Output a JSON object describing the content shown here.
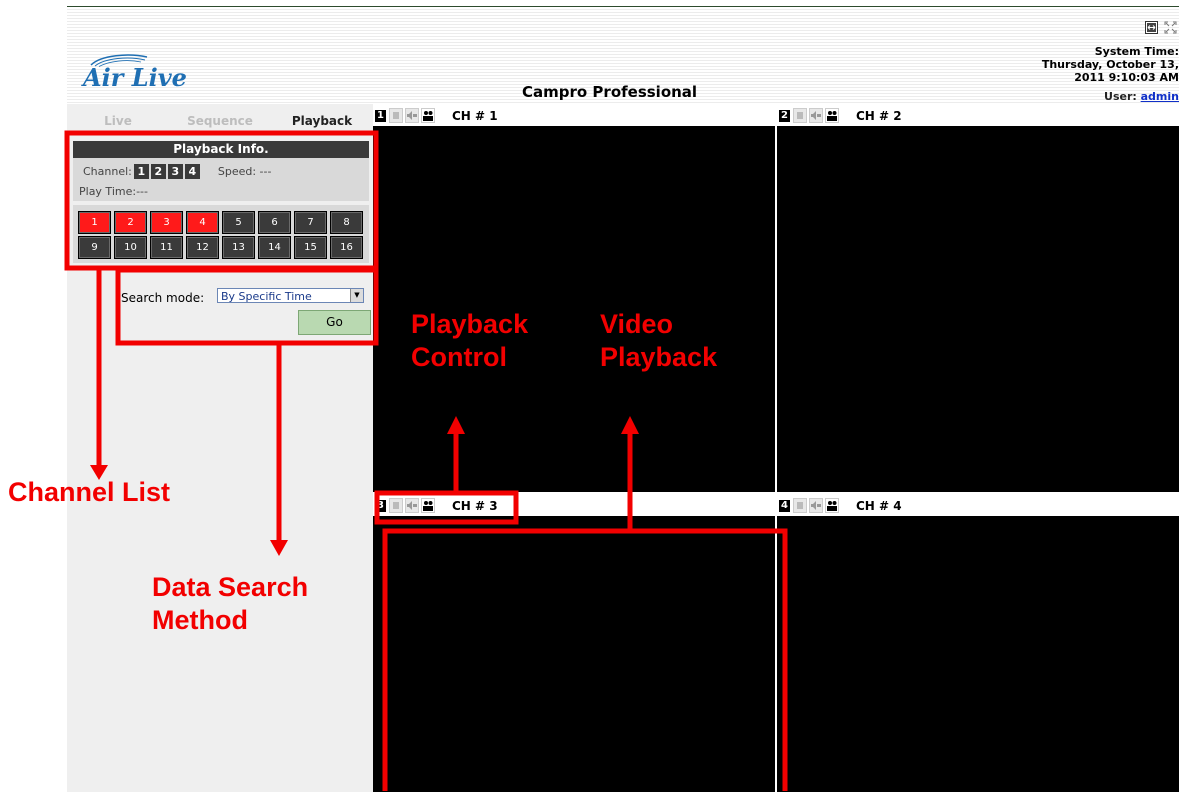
{
  "header": {
    "logo_text": "Air Live",
    "app_title": "Campro Professional",
    "system_time_label": "System Time:",
    "date_line1": "Thursday, October 13,",
    "date_line2": "2011 9:10:03 AM",
    "user_label": "User:",
    "user_name": "admin",
    "icons": [
      "fit-window-icon",
      "fullscreen-icon"
    ]
  },
  "tabs": [
    {
      "label": "Live",
      "active": false
    },
    {
      "label": "Sequence",
      "active": false
    },
    {
      "label": "Playback",
      "active": true
    }
  ],
  "playback_info": {
    "title": "Playback Info.",
    "channel_label": "Channel:",
    "channel_numbers": [
      "1",
      "2",
      "3",
      "4"
    ],
    "speed_label": "Speed: ---",
    "play_time_label": "Play Time:---"
  },
  "channel_grid": {
    "buttons": [
      "1",
      "2",
      "3",
      "4",
      "5",
      "6",
      "7",
      "8",
      "9",
      "10",
      "11",
      "12",
      "13",
      "14",
      "15",
      "16"
    ],
    "selected": [
      "1",
      "2",
      "3",
      "4"
    ]
  },
  "search": {
    "label": "Search mode:",
    "selected_option": "By Specific Time",
    "go_label": "Go"
  },
  "video_cells": [
    {
      "number": "1",
      "label": "CH # 1"
    },
    {
      "number": "2",
      "label": "CH # 2"
    },
    {
      "number": "3",
      "label": "CH # 3"
    },
    {
      "number": "4",
      "label": "CH # 4"
    }
  ],
  "annotations": {
    "playback_control_1": "Playback",
    "playback_control_2": "Control",
    "video_playback_1": "Video",
    "video_playback_2": "Playback",
    "channel_list": "Channel List",
    "data_search_1": "Data Search",
    "data_search_2": "Method",
    "color": "#f20000"
  },
  "colors": {
    "selected_channel": "#ff1a1a",
    "go_button": "#b9d9b1",
    "logo_blue": "#1f6fb3"
  }
}
